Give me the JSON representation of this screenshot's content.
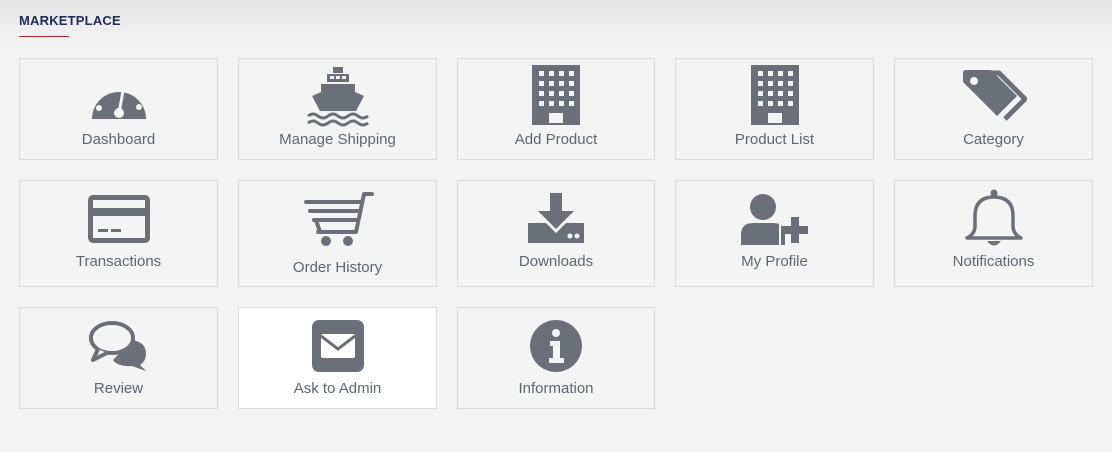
{
  "section": {
    "title": "MARKETPLACE"
  },
  "tiles": [
    {
      "label": "Dashboard",
      "icon": "dashboard-icon"
    },
    {
      "label": "Manage Shipping",
      "icon": "ship-icon"
    },
    {
      "label": "Add Product",
      "icon": "building-icon"
    },
    {
      "label": "Product List",
      "icon": "building-icon"
    },
    {
      "label": "Category",
      "icon": "tags-icon"
    },
    {
      "label": "Transactions",
      "icon": "credit-card-icon"
    },
    {
      "label": "Order History",
      "icon": "cart-icon"
    },
    {
      "label": "Downloads",
      "icon": "download-icon"
    },
    {
      "label": "My Profile",
      "icon": "user-plus-icon"
    },
    {
      "label": "Notifications",
      "icon": "bell-icon"
    },
    {
      "label": "Review",
      "icon": "comments-icon"
    },
    {
      "label": "Ask to Admin",
      "icon": "envelope-icon"
    },
    {
      "label": "Information",
      "icon": "info-icon"
    }
  ],
  "colors": {
    "icon": "#6b7078",
    "accent": "#c0263a",
    "title": "#1e2a5a"
  }
}
